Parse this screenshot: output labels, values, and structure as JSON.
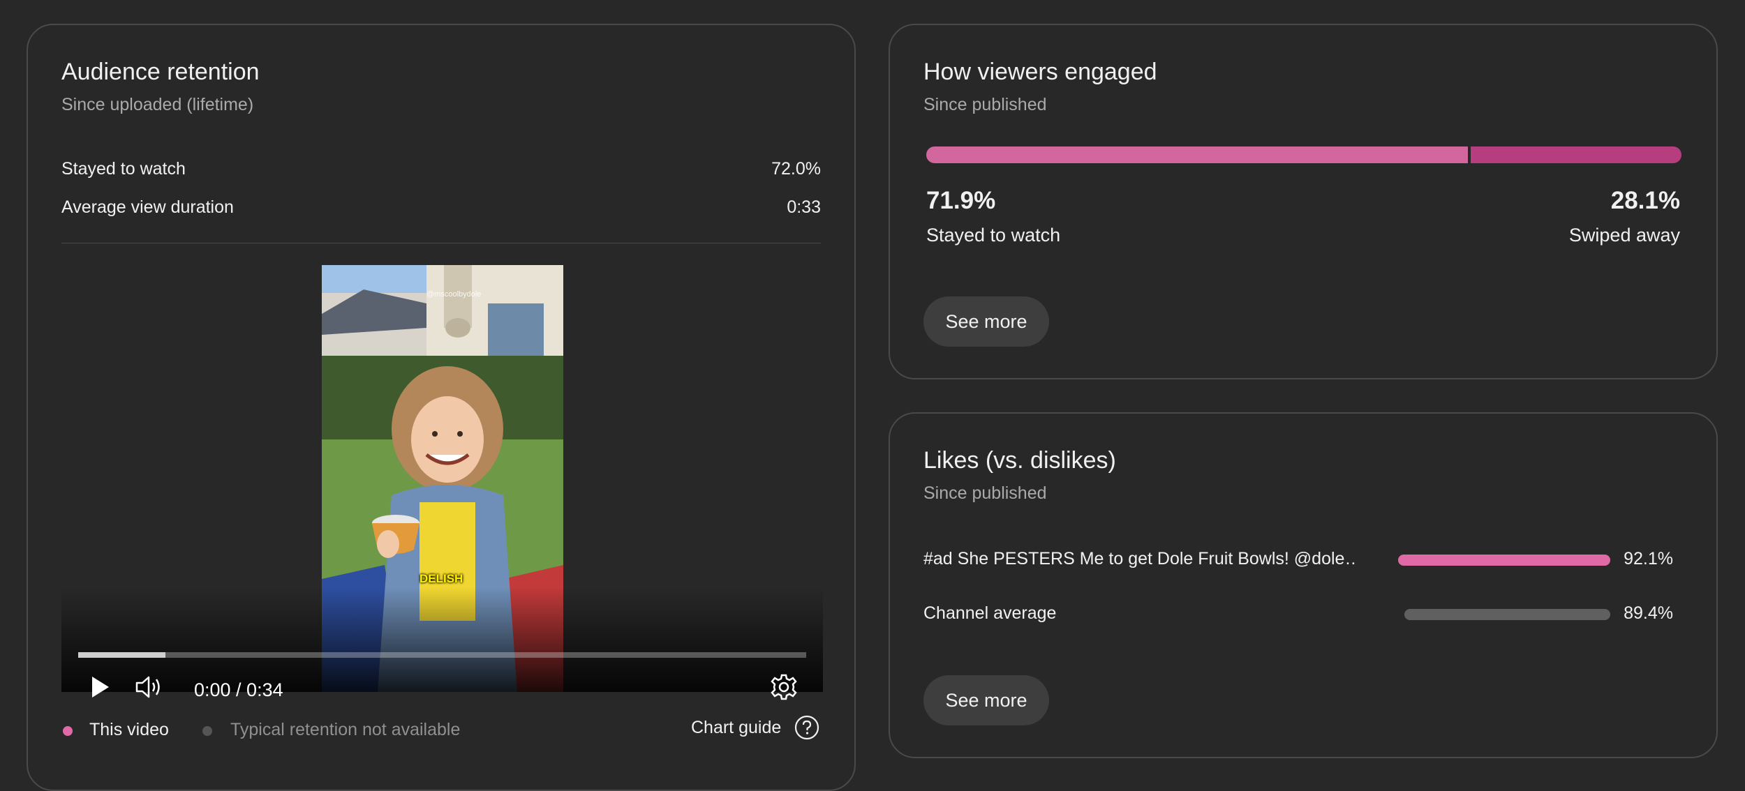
{
  "retention": {
    "title": "Audience retention",
    "subtitle": "Since uploaded (lifetime)",
    "stayed_label": "Stayed to watch",
    "stayed_value": "72.0%",
    "avd_label": "Average view duration",
    "avd_value": "0:33",
    "player": {
      "time": "0:00 / 0:34",
      "caption": "DELISH",
      "watermark": "@mscoolbydole",
      "progress_fraction": 0.12,
      "play_icon": "play-icon",
      "volume_icon": "volume-icon",
      "settings_icon": "gear-icon"
    },
    "legend": {
      "this_video": "This video",
      "typical": "Typical retention not available",
      "chart_guide": "Chart guide",
      "help_icon": "help-icon",
      "this_video_color": "#e06aa6",
      "typical_color": "#555555"
    }
  },
  "engaged": {
    "title": "How viewers engaged",
    "subtitle": "Since published",
    "stayed_pct": "71.9%",
    "stayed_label": "Stayed to watch",
    "swiped_pct": "28.1%",
    "swiped_label": "Swiped away",
    "stayed_fraction": 0.719,
    "stayed_color": "#d2679e",
    "swiped_color": "#b63e7f",
    "see_more": "See more"
  },
  "likes": {
    "title": "Likes (vs. dislikes)",
    "subtitle": "Since published",
    "rows": [
      {
        "label": "#ad She PESTERS Me to get Dole Fruit Bowls! @dole…",
        "value": "92.1%",
        "fraction": 0.921,
        "color": "#e06aa6"
      },
      {
        "label": "Channel average",
        "value": "89.4%",
        "fraction": 0.894,
        "color": "#606060"
      }
    ],
    "see_more": "See more"
  }
}
